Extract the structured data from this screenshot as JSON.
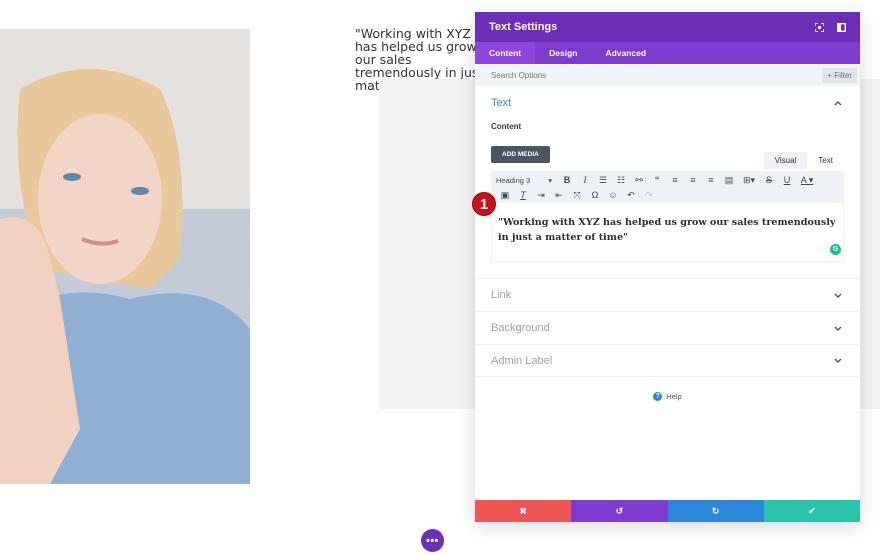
{
  "page": {
    "quote_preview": "\"Working with XYZ has helped us grow our sales tremendously in just a matter of time\"",
    "photo": {
      "icon": "portrait-photo",
      "alt": "woman resting chin on hand"
    }
  },
  "modal": {
    "title": "Text Settings",
    "header_icons": [
      "expand-icon",
      "sidebar-toggle-icon"
    ],
    "tabs": [
      {
        "label": "Content",
        "active": true
      },
      {
        "label": "Design",
        "active": false
      },
      {
        "label": "Advanced",
        "active": false
      }
    ],
    "search": {
      "placeholder": "Search Options",
      "value": ""
    },
    "filter_label": "+ Filter",
    "sections": {
      "text": {
        "title": "Text",
        "content_label": "Content",
        "add_media_label": "ADD MEDIA",
        "editor_tabs": [
          {
            "label": "Visual",
            "active": true
          },
          {
            "label": "Text",
            "active": false
          }
        ],
        "format_select": "Heading 3",
        "toolbar_row1": [
          "bold",
          "italic",
          "bullet-list",
          "numbered-list",
          "link",
          "blockquote",
          "align-left",
          "align-center",
          "align-right",
          "justify",
          "table",
          "strikethrough",
          "underline",
          "text-color"
        ],
        "toolbar_row2": [
          "paste-text",
          "clear-formatting",
          "indent",
          "outdent",
          "fullscreen",
          "special-char",
          "emoji",
          "undo",
          "redo"
        ],
        "editor_content": "\"Working with XYZ has helped us grow our sales tremendously in just a matter of time\""
      },
      "closed": [
        {
          "title": "Link"
        },
        {
          "title": "Background"
        },
        {
          "title": "Admin Label"
        }
      ]
    },
    "help_label": "Help",
    "step_badge": "1",
    "footer": {
      "cancel": "✖",
      "undo": "↺",
      "redo": "↻",
      "save": "✔"
    }
  },
  "more_button": "•••",
  "colors": {
    "header": "#6c2eb9",
    "tabs": "#7e3bd0",
    "accent_blue": "#2b87da",
    "cancel": "#ef5555",
    "save": "#29c4a9",
    "badge": "#c8111a"
  }
}
